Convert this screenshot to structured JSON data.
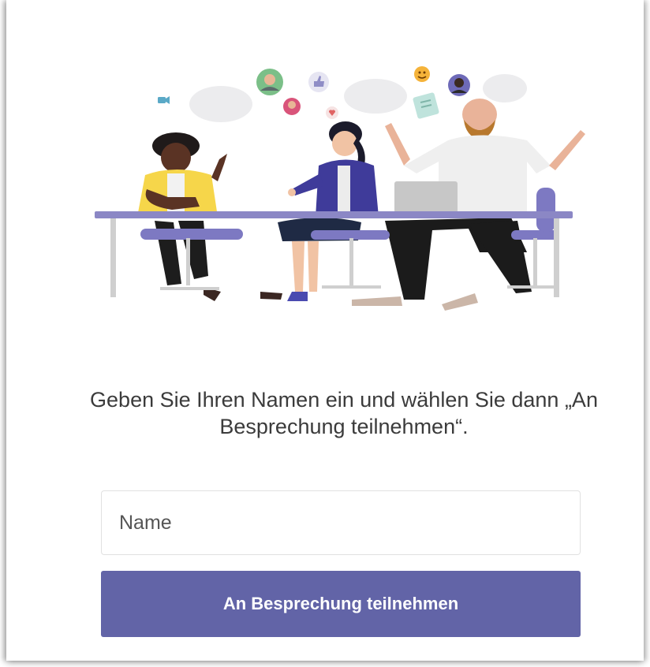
{
  "join": {
    "prompt": "Geben Sie Ihren Namen ein und wählen Sie dann „An Besprechung teilnehmen“.",
    "name_placeholder": "Name",
    "name_value": "",
    "join_button_label": "An Besprechung teilnehmen"
  },
  "colors": {
    "accent": "#6264a7",
    "table": "#8b87c5",
    "chair": "#7d79c2",
    "bubble": "#ececee"
  },
  "illustration": {
    "icons": [
      "video-icon",
      "avatar-man-icon",
      "thumbs-up-icon",
      "avatar-woman-icon",
      "heart-icon",
      "emoji-icon",
      "avatar-dark-icon",
      "document-icon"
    ]
  }
}
